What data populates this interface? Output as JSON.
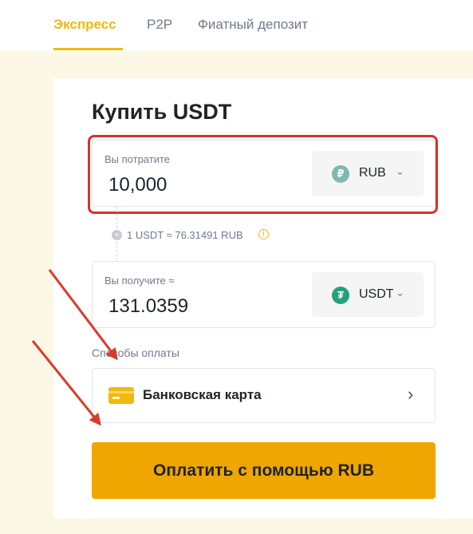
{
  "tabs": [
    {
      "label": "Экспресс",
      "active": true
    },
    {
      "label": "P2P",
      "active": false
    },
    {
      "label": "Фиатный депозит",
      "active": false
    }
  ],
  "title": "Купить USDT",
  "spend": {
    "label": "Вы потратите",
    "value": "10,000",
    "currency": "RUB",
    "coin_glyph": "₽",
    "icon": "ruble-coin-icon"
  },
  "rate": {
    "text": "1 USDT ≈ 76.31491 RUB"
  },
  "receive": {
    "label": "Вы получите ≈",
    "value": "131.0359",
    "currency": "USDT",
    "coin_glyph": "₮",
    "icon": "tether-coin-icon"
  },
  "payment": {
    "label": "Способы оплаты",
    "method": "Банковская карта",
    "icon": "bank-card-icon"
  },
  "pay_button": "Оплатить с помощью RUB",
  "colors": {
    "accent": "#f0b90b",
    "button": "#f0a600",
    "highlight": "#d9312b",
    "annotation_arrow": "#d93b2b"
  }
}
